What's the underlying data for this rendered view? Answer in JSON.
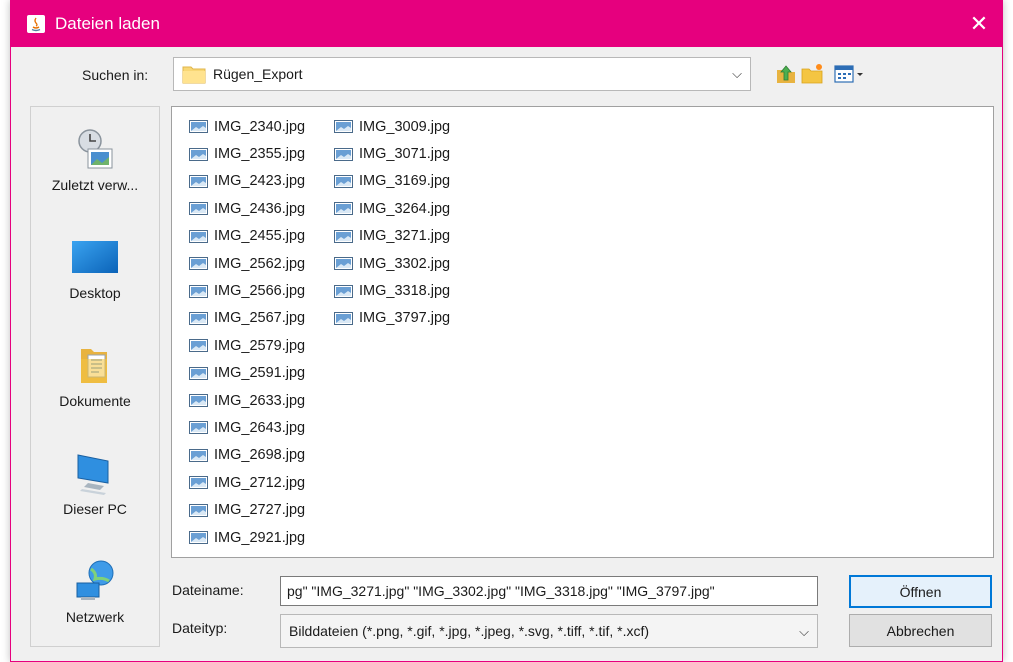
{
  "window": {
    "title": "Dateien laden",
    "close_glyph": "✕",
    "accent": "#e6007e"
  },
  "lookin": {
    "label": "Suchen in:",
    "value": "Rügen_Export",
    "arrow": "⌵"
  },
  "toolbar": {
    "icons": [
      "up-folder-icon",
      "new-folder-icon",
      "view-menu-icon"
    ]
  },
  "places": [
    {
      "label": "Zuletzt verw...",
      "icon": "recent-icon"
    },
    {
      "label": "Desktop",
      "icon": "desktop-icon"
    },
    {
      "label": "Dokumente",
      "icon": "documents-icon"
    },
    {
      "label": "Dieser PC",
      "icon": "computer-icon"
    },
    {
      "label": "Netzwerk",
      "icon": "network-icon"
    }
  ],
  "files": {
    "column1": [
      "IMG_2340.jpg",
      "IMG_2355.jpg",
      "IMG_2423.jpg",
      "IMG_2436.jpg",
      "IMG_2455.jpg",
      "IMG_2562.jpg",
      "IMG_2566.jpg",
      "IMG_2567.jpg",
      "IMG_2579.jpg",
      "IMG_2591.jpg",
      "IMG_2633.jpg",
      "IMG_2643.jpg",
      "IMG_2698.jpg",
      "IMG_2712.jpg",
      "IMG_2727.jpg",
      "IMG_2921.jpg"
    ],
    "column2": [
      "IMG_3009.jpg",
      "IMG_3071.jpg",
      "IMG_3169.jpg",
      "IMG_3264.jpg",
      "IMG_3271.jpg",
      "IMG_3302.jpg",
      "IMG_3318.jpg",
      "IMG_3797.jpg"
    ]
  },
  "filename": {
    "label": "Dateiname:",
    "value": "pg\" \"IMG_3271.jpg\" \"IMG_3302.jpg\" \"IMG_3318.jpg\" \"IMG_3797.jpg\""
  },
  "filetype": {
    "label": "Dateityp:",
    "value": "Bilddateien (*.png, *.gif, *.jpg, *.jpeg, *.svg, *.tiff, *.tif, *.xcf)",
    "arrow": "⌵"
  },
  "buttons": {
    "open": "Öffnen",
    "cancel": "Abbrechen"
  }
}
